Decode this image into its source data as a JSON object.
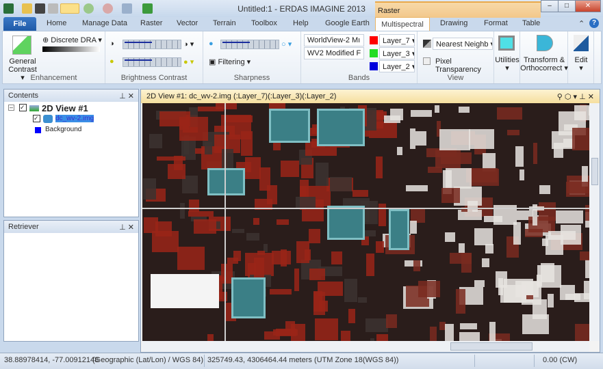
{
  "title": "Untitled:1 - ERDAS IMAGINE 2013",
  "context_tab": "Raster",
  "tabs": [
    "File",
    "Home",
    "Manage Data",
    "Raster",
    "Vector",
    "Terrain",
    "Toolbox",
    "Help",
    "Google Earth",
    "Multispectral",
    "Drawing",
    "Format",
    "Table"
  ],
  "active_tab": "Multispectral",
  "ribbon": {
    "enhancement": {
      "label": "Enhancement",
      "general_contrast": "General",
      "general_contrast2": "Contrast ▾",
      "dra": "Discrete DRA"
    },
    "brightness": {
      "label": "Brightness Contrast"
    },
    "sharpness": {
      "label": "Sharpness",
      "filtering": "Filtering"
    },
    "bands": {
      "label": "Bands",
      "sensor": "WorldView-2 Mı",
      "bandcombo": "WV2 Modified F",
      "red": "Layer_7",
      "green": "Layer_3",
      "blue": "Layer_2",
      "colors": {
        "red": "#ff0000",
        "green": "#22dd22",
        "blue": "#0000dd"
      }
    },
    "view": {
      "label": "View",
      "resample": "Nearest Neighb",
      "pixel_transparency": "Pixel Transparency"
    },
    "utilities": "Utilities",
    "transform": "Transform &",
    "transform2": "Orthocorrect ▾",
    "edit": "Edit"
  },
  "contents": {
    "title": "Contents",
    "view": "2D View #1",
    "layer": "dc_wv-2.img",
    "background": "Background"
  },
  "retriever": {
    "title": "Retriever"
  },
  "viewer": {
    "title": "2D View #1: dc_wv-2.img (:Layer_7)(:Layer_3)(:Layer_2)"
  },
  "status": {
    "latlon": "38.88978414, -77.00912148",
    "latlon_proj": "(Geographic (Lat/Lon) / WGS 84)",
    "utm": "325749.43, 4306464.44 meters (UTM Zone 18(WGS 84))",
    "rotation": "0.00 (CW)"
  }
}
